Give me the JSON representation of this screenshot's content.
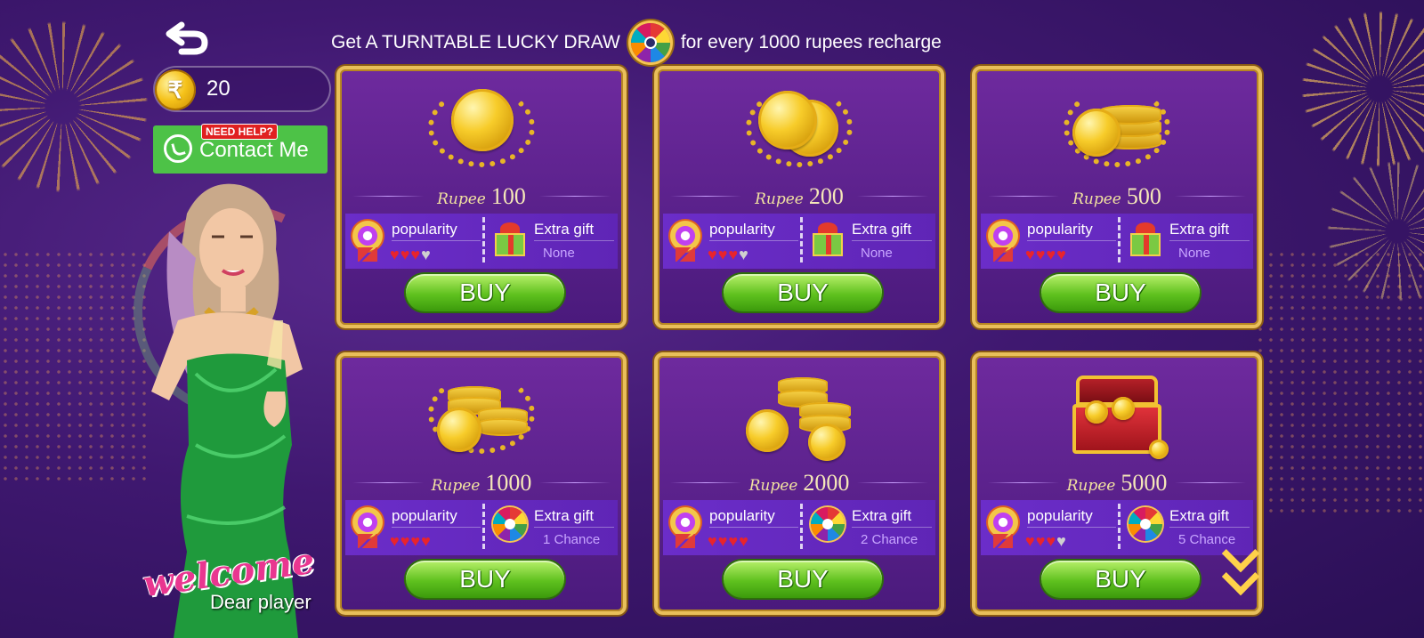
{
  "header": {
    "promo_prefix": "Get A TURNTABLE LUCKY DRAW",
    "promo_suffix": "for every 1000 rupees recharge"
  },
  "sidebar": {
    "balance": "20",
    "currency_symbol": "₹",
    "help_badge": "NEED HELP?",
    "contact_label": "Contact Me",
    "welcome": "welcome",
    "welcome_sub": "Dear player"
  },
  "packs": [
    {
      "price_word": "Rupee",
      "price": "100",
      "popularity_label": "popularity",
      "popularity": 3,
      "popularity_max": 4,
      "gift_label": "Extra gift",
      "gift_value": "None",
      "gift_icon": "gift-box",
      "buy_label": "BUY",
      "art": "single-coin-laurel"
    },
    {
      "price_word": "Rupee",
      "price": "200",
      "popularity_label": "popularity",
      "popularity": 3,
      "popularity_max": 4,
      "gift_label": "Extra gift",
      "gift_value": "None",
      "gift_icon": "gift-box",
      "buy_label": "BUY",
      "art": "two-coins-laurel"
    },
    {
      "price_word": "Rupee",
      "price": "500",
      "popularity_label": "popularity",
      "popularity": 4,
      "popularity_max": 4,
      "gift_label": "Extra gift",
      "gift_value": "None",
      "gift_icon": "gift-box",
      "buy_label": "BUY",
      "art": "coin-stack-laurel"
    },
    {
      "price_word": "Rupee",
      "price": "1000",
      "popularity_label": "popularity",
      "popularity": 4,
      "popularity_max": 4,
      "gift_label": "Extra gift",
      "gift_value": "1 Chance",
      "gift_icon": "lucky-wheel",
      "buy_label": "BUY",
      "art": "coin-stacks-laurel"
    },
    {
      "price_word": "Rupee",
      "price": "2000",
      "popularity_label": "popularity",
      "popularity": 4,
      "popularity_max": 4,
      "gift_label": "Extra gift",
      "gift_value": "2 Chance",
      "gift_icon": "lucky-wheel",
      "buy_label": "BUY",
      "art": "large-coin-stacks"
    },
    {
      "price_word": "Rupee",
      "price": "5000",
      "popularity_label": "popularity",
      "popularity": 3,
      "popularity_max": 4,
      "gift_label": "Extra gift",
      "gift_value": "5 Chance",
      "gift_icon": "lucky-wheel",
      "buy_label": "BUY",
      "art": "treasure-chest"
    }
  ],
  "colors": {
    "background": "#3f1870",
    "card_border": "#e9bf5a",
    "buy_button": "#5fc11e",
    "contact_button": "#4dc247",
    "heart_on": "#e8242c",
    "heart_off": "#cfcfcf"
  }
}
